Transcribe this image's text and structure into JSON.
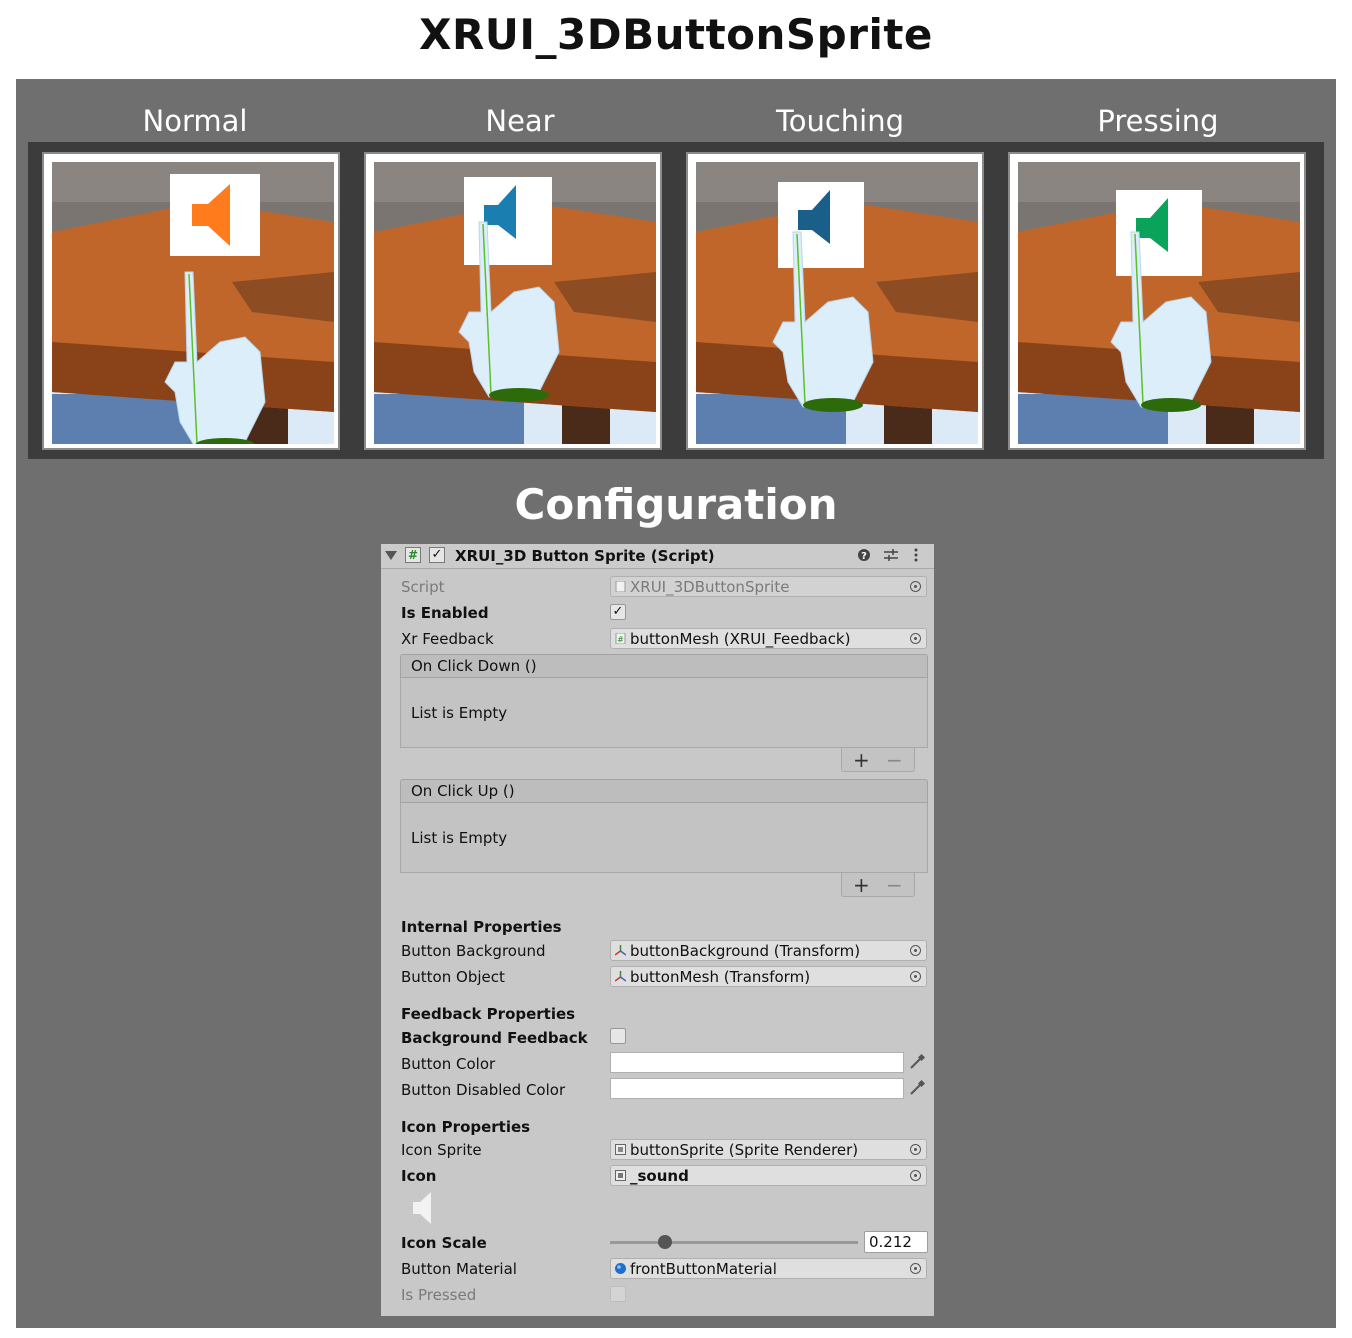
{
  "title": "XRUI_3DButtonSprite",
  "states": [
    {
      "label": "Normal",
      "icon_color": "#ff7b1c"
    },
    {
      "label": "Near",
      "icon_color": "#1a7fb0"
    },
    {
      "label": "Touching",
      "icon_color": "#1a5e8a"
    },
    {
      "label": "Pressing",
      "icon_color": "#0aa35a"
    }
  ],
  "config_title": "Configuration",
  "inspector": {
    "component_title": "XRUI_3D Button Sprite (Script)",
    "enabled_check": "✓",
    "script": {
      "label": "Script",
      "value": "XRUI_3DButtonSprite"
    },
    "is_enabled": {
      "label": "Is Enabled",
      "check": "✓"
    },
    "xr_feedback": {
      "label": "Xr Feedback",
      "value": "buttonMesh (XRUI_Feedback)"
    },
    "on_click_down": {
      "header": "On Click Down ()",
      "empty": "List is Empty",
      "plus": "+",
      "minus": "−"
    },
    "on_click_up": {
      "header": "On Click Up ()",
      "empty": "List is Empty",
      "plus": "+",
      "minus": "−"
    },
    "internal": {
      "heading": "Internal Properties",
      "button_background": {
        "label": "Button Background",
        "value": "buttonBackground (Transform)"
      },
      "button_object": {
        "label": "Button Object",
        "value": "buttonMesh (Transform)"
      }
    },
    "feedback": {
      "heading": "Feedback Properties",
      "background_feedback": {
        "label": "Background Feedback"
      },
      "button_color": {
        "label": "Button Color",
        "color": "#ffffff"
      },
      "button_disabled_color": {
        "label": "Button Disabled Color",
        "color": "#ffffff"
      }
    },
    "icon_props": {
      "heading": "Icon Properties",
      "icon_sprite": {
        "label": "Icon Sprite",
        "value": "buttonSprite (Sprite Renderer)"
      },
      "icon": {
        "label": "Icon",
        "value": "_sound"
      },
      "icon_scale": {
        "label": "Icon Scale",
        "value": "0.212",
        "slider_fraction": 0.22
      },
      "button_material": {
        "label": "Button Material",
        "value": "frontButtonMaterial"
      },
      "is_pressed": {
        "label": "Is Pressed"
      }
    }
  }
}
